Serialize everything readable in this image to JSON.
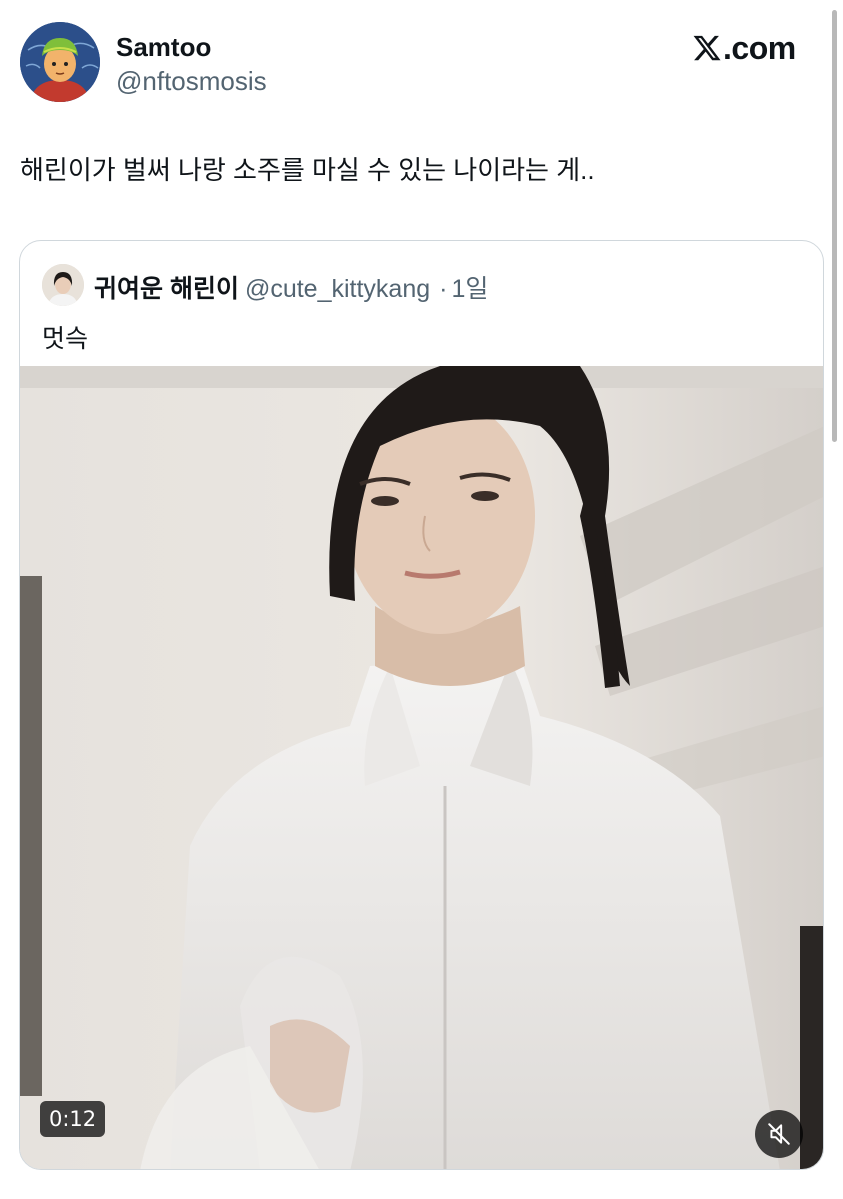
{
  "author": {
    "name": "Samtoo",
    "handle": "@nftosmosis",
    "avatar_icon": "illustrated-avatar"
  },
  "brand": {
    "logo_icon": "x-logo-icon",
    "label": ".com"
  },
  "tweet": {
    "text": "해린이가 벌써 나랑 소주를 마실 수 있는 나이라는 게.."
  },
  "quoted": {
    "name": "귀여운 해린이",
    "handle": "@cute_kittykang",
    "separator": "·",
    "time": "1일",
    "text": "멋슥",
    "video": {
      "duration": "0:12",
      "mute_icon": "speaker-muted-icon"
    }
  },
  "colors": {
    "text_primary": "#0f1419",
    "text_secondary": "#536471",
    "border": "#d0d7dc"
  }
}
